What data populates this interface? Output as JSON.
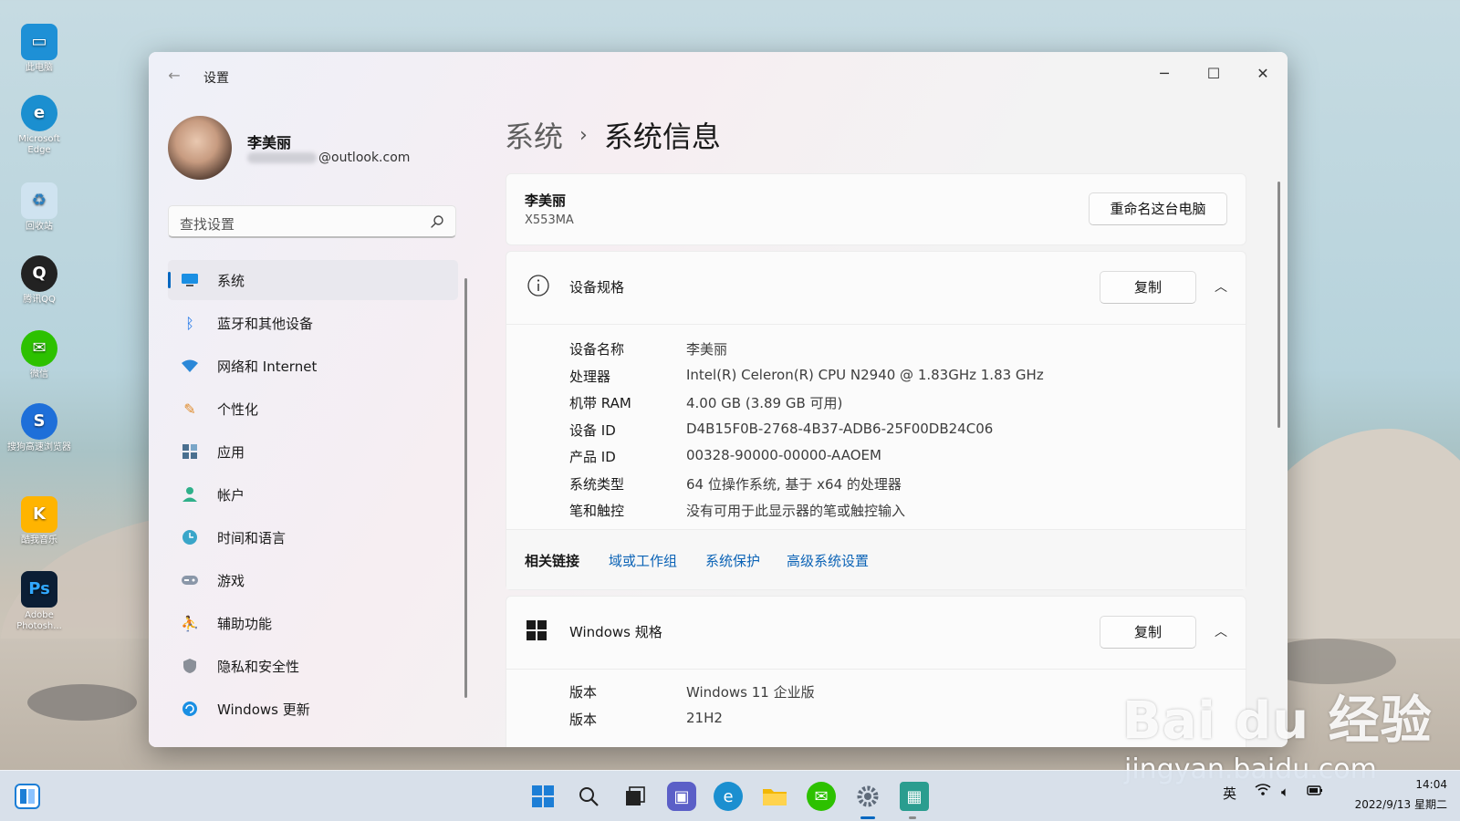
{
  "desktop": {
    "icons": [
      {
        "label": "此电脑",
        "icon": "monitor-icon",
        "color": "#1e90d6"
      },
      {
        "label": "Microsoft Edge",
        "icon": "edge-icon",
        "color": "#1b8fd0"
      },
      {
        "label": "回收站",
        "icon": "recycle-bin-icon",
        "color": "#5aa0d8"
      },
      {
        "label": "腾讯QQ",
        "icon": "qq-penguin-icon",
        "color": "#222222"
      },
      {
        "label": "微信",
        "icon": "wechat-icon",
        "color": "#2dc100"
      },
      {
        "label": "搜狗高速浏览器",
        "icon": "sogou-browser-icon",
        "color": "#1e6fd9"
      },
      {
        "label": "酷我音乐",
        "icon": "kuwo-music-icon",
        "color": "#ffb400"
      },
      {
        "label": "Adobe Photosh...",
        "icon": "photoshop-icon",
        "color": "#0b1e35"
      }
    ]
  },
  "window": {
    "title": "设置",
    "back_icon": "back-arrow-icon",
    "controls": {
      "minimize": "─",
      "maximize": "☐",
      "close": "✕"
    }
  },
  "profile": {
    "name": "李美丽",
    "email_domain": "@outlook.com"
  },
  "search": {
    "placeholder": "查找设置"
  },
  "nav": {
    "items": [
      {
        "label": "系统",
        "icon": "system-display-icon",
        "active": true
      },
      {
        "label": "蓝牙和其他设备",
        "icon": "bluetooth-icon"
      },
      {
        "label": "网络和 Internet",
        "icon": "wifi-icon"
      },
      {
        "label": "个性化",
        "icon": "brush-icon"
      },
      {
        "label": "应用",
        "icon": "apps-icon"
      },
      {
        "label": "帐户",
        "icon": "account-icon"
      },
      {
        "label": "时间和语言",
        "icon": "time-language-icon"
      },
      {
        "label": "游戏",
        "icon": "gamepad-icon"
      },
      {
        "label": "辅助功能",
        "icon": "accessibility-icon"
      },
      {
        "label": "隐私和安全性",
        "icon": "shield-icon"
      },
      {
        "label": "Windows 更新",
        "icon": "windows-update-icon"
      }
    ]
  },
  "breadcrumb": {
    "parent": "系统",
    "separator": "›",
    "current": "系统信息"
  },
  "device": {
    "name": "李美丽",
    "model": "X553MA",
    "rename_button": "重命名这台电脑"
  },
  "device_specs": {
    "title": "设备规格",
    "copy_button": "复制",
    "rows": [
      {
        "label": "设备名称",
        "value": "李美丽"
      },
      {
        "label": "处理器",
        "value": "Intel(R) Celeron(R) CPU  N2940  @ 1.83GHz   1.83 GHz"
      },
      {
        "label": "机带 RAM",
        "value": "4.00 GB (3.89 GB 可用)"
      },
      {
        "label": "设备 ID",
        "value": "D4B15F0B-2768-4B37-ADB6-25F00DB24C06"
      },
      {
        "label": "产品 ID",
        "value": "00328-90000-00000-AAOEM"
      },
      {
        "label": "系统类型",
        "value": "64 位操作系统, 基于 x64 的处理器"
      },
      {
        "label": "笔和触控",
        "value": "没有可用于此显示器的笔或触控输入"
      }
    ]
  },
  "related_links": {
    "label": "相关链接",
    "links": [
      "域或工作组",
      "系统保护",
      "高级系统设置"
    ]
  },
  "windows_specs": {
    "title": "Windows 规格",
    "copy_button": "复制",
    "rows": [
      {
        "label": "版本",
        "value": "Windows 11 企业版"
      },
      {
        "label": "版本",
        "value": "21H2"
      }
    ]
  },
  "watermark": {
    "main": "Bai du 经验",
    "sub": "jingyan.baidu.com"
  },
  "taskbar": {
    "apps": [
      {
        "name": "start",
        "icon": "windows-start-icon",
        "color": "#1c7ed6"
      },
      {
        "name": "search",
        "icon": "search-icon",
        "color": "#222222"
      },
      {
        "name": "task-view",
        "icon": "task-view-icon",
        "color": "#222222"
      },
      {
        "name": "chat",
        "icon": "teams-chat-icon",
        "color": "#5b5fc7"
      },
      {
        "name": "edge",
        "icon": "edge-icon",
        "color": "#1b8fd0"
      },
      {
        "name": "file-explorer",
        "icon": "folder-icon",
        "color": "#f2b705"
      },
      {
        "name": "wechat",
        "icon": "wechat-icon",
        "color": "#2dc100"
      },
      {
        "name": "settings",
        "icon": "gear-icon",
        "color": "#5f6b7a",
        "active": true
      },
      {
        "name": "app",
        "icon": "app-icon",
        "color": "#2a9d8f"
      }
    ],
    "tray": {
      "ime": "英",
      "time": "14:04",
      "date": "2022/9/13 星期二"
    }
  }
}
